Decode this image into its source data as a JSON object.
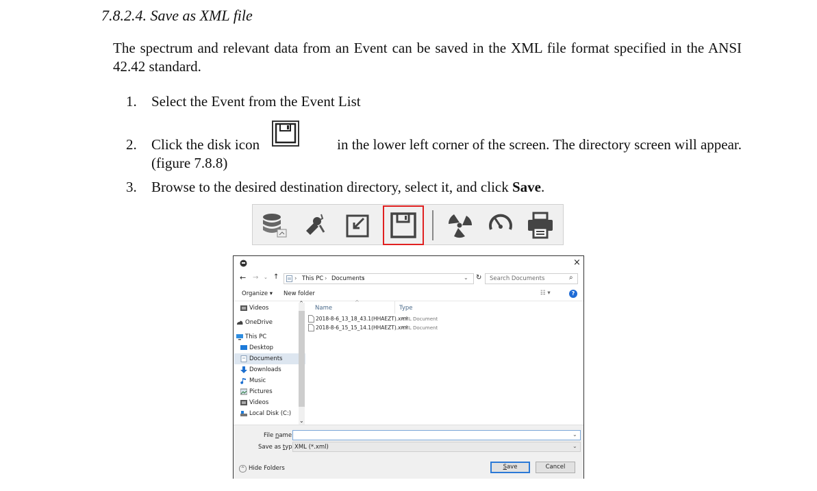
{
  "doc": {
    "heading": "7.8.2.4. Save as XML file",
    "paragraph": "The spectrum and relevant data from an Event can be saved in the XML file format specified in the ANSI 42.42 standard.",
    "steps": [
      {
        "num": "1.",
        "text": "Select the Event from the Event List"
      },
      {
        "num": "2.",
        "text_before": "Click the disk icon",
        "text_after": "in the lower left corner of the screen. The directory screen will appear.",
        "text_line2": "(figure 7.8.8)"
      },
      {
        "num": "3.",
        "text_before": "Browse to the desired destination directory, select it, and click ",
        "text_bold": "Save",
        "text_after": "."
      }
    ]
  },
  "toolbar": {
    "icons": [
      "database-icon",
      "tools-icon",
      "import-icon",
      "save-disk-icon",
      "radiation-icon",
      "gauge-icon",
      "print-icon"
    ],
    "highlight_color": "#e02020"
  },
  "dialog": {
    "close": "×",
    "breadcrumb": {
      "this_pc": "This PC",
      "documents": "Documents",
      "sep": "›"
    },
    "search_placeholder": "Search Documents",
    "organize": "Organize ▾",
    "new_folder": "New folder",
    "help": "?",
    "nav_items": [
      "Videos",
      "OneDrive",
      "This PC",
      "Desktop",
      "Documents",
      "Downloads",
      "Music",
      "Pictures",
      "Videos",
      "Local Disk (C:)"
    ],
    "columns": {
      "name": "Name",
      "type": "Type"
    },
    "files": [
      {
        "name": "2018-8-6_13_18_43.1(HHAEZT).xml",
        "type": "XML Document"
      },
      {
        "name": "2018-8-6_15_15_14.1(HHAEZT).xml",
        "type": "XML Document"
      }
    ],
    "file_name_label_pre": "File ",
    "file_name_label_u": "n",
    "file_name_label_post": "ame:",
    "save_type_label_pre": "Save as ",
    "save_type_label_u": "t",
    "save_type_label_post": "ype:",
    "save_type_value": "XML (*.xml)",
    "hide_folders": "Hide Folders",
    "save_u": "S",
    "save_rest": "ave",
    "cancel": "Cancel"
  }
}
